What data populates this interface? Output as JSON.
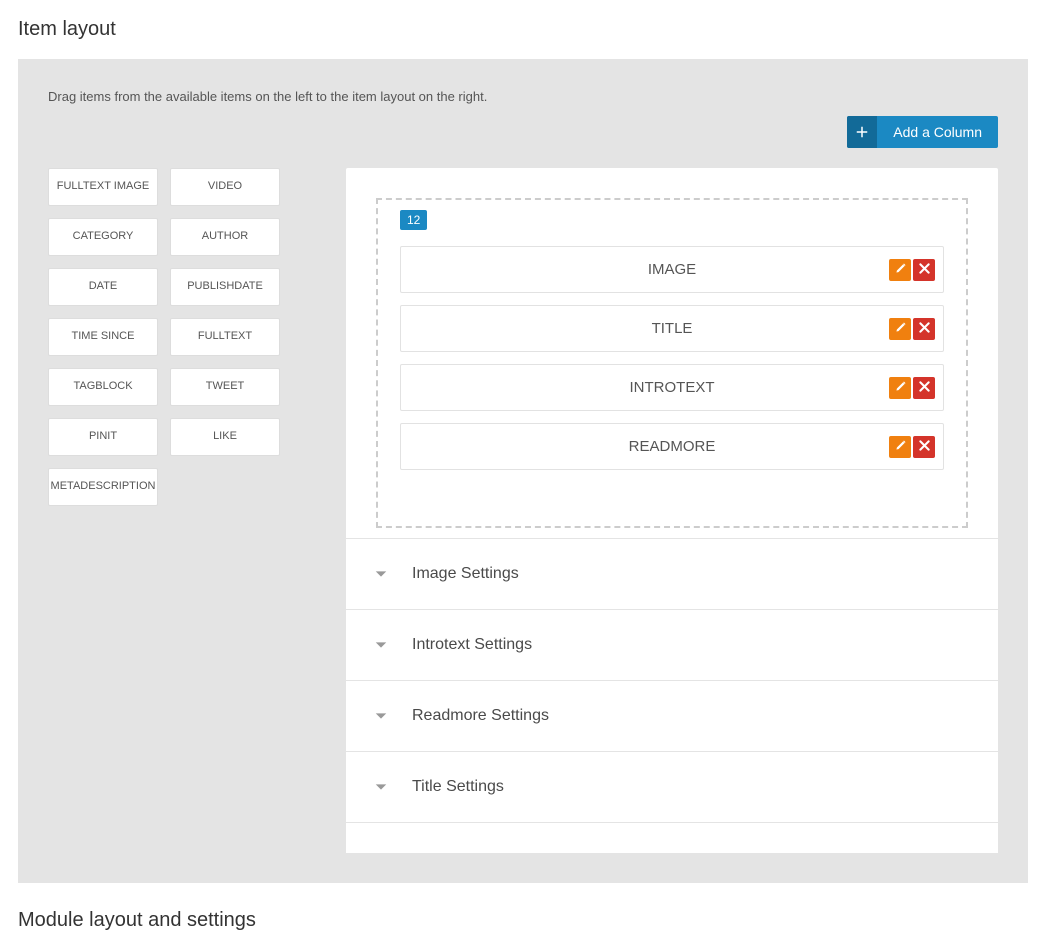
{
  "section_title": "Item layout",
  "description": "Drag items from the available items on the left to the item layout on the right.",
  "add_column": {
    "label": "Add a Column"
  },
  "available_items": [
    "FULLTEXT IMAGE",
    "VIDEO",
    "CATEGORY",
    "AUTHOR",
    "DATE",
    "PUBLISHDATE",
    "TIME SINCE",
    "FULLTEXT",
    "TAGBLOCK",
    "TWEET",
    "PINIT",
    "LIKE",
    "METADESCRIPTION"
  ],
  "layout_column": {
    "width_badge": "12",
    "placed": [
      "IMAGE",
      "TITLE",
      "INTROTEXT",
      "READMORE"
    ]
  },
  "accordion": [
    "Image Settings",
    "Introtext Settings",
    "Readmore Settings",
    "Title Settings"
  ],
  "footer_title": "Module layout and settings",
  "colors": {
    "primary": "#1b89c3",
    "warn": "#f0800f",
    "danger": "#d4342a",
    "panel_bg": "#e4e4e4"
  }
}
